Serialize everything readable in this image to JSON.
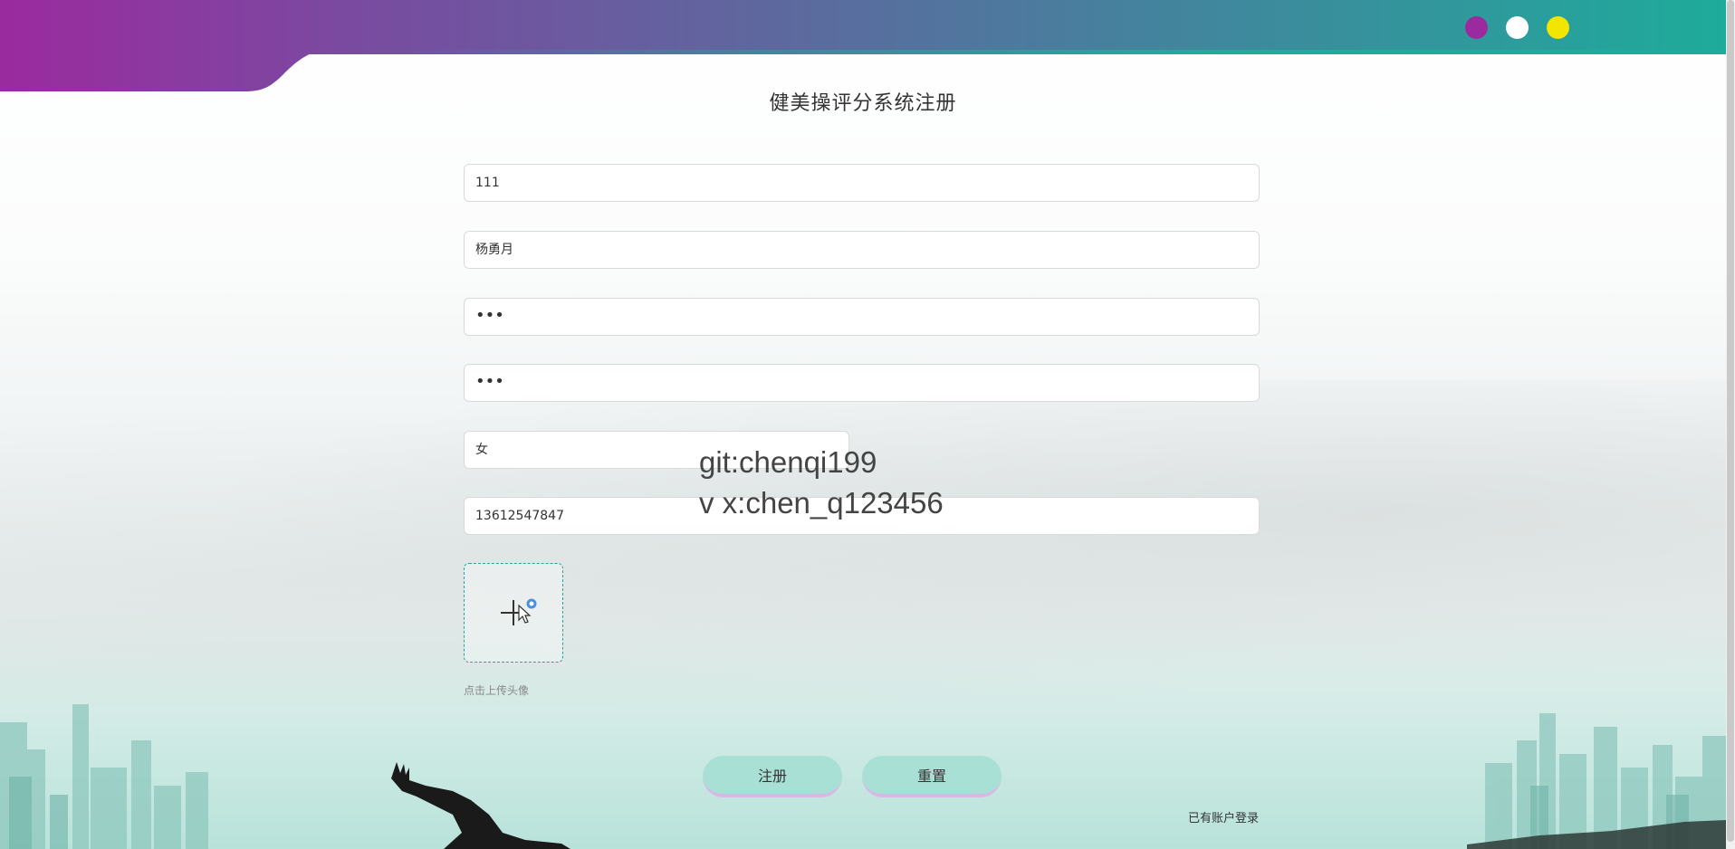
{
  "page": {
    "title": "健美操评分系统注册"
  },
  "theme": {
    "accent": "#1eab9b",
    "brand_purple": "#9b2a9f",
    "color_dots": [
      "#9b2a9f",
      "#ffffff",
      "#f2e600"
    ]
  },
  "form": {
    "account": {
      "value": "111"
    },
    "name": {
      "value": "杨勇月"
    },
    "password": {
      "value": "•••"
    },
    "confirm_password": {
      "value": "•••"
    },
    "gender": {
      "value": "女"
    },
    "phone": {
      "value": "13612547847"
    },
    "upload_hint": "点击上传头像"
  },
  "watermark": {
    "line1": "git:chenqi199",
    "line2": "v x:chen_q123456"
  },
  "buttons": {
    "register": "注册",
    "reset": "重置"
  },
  "login_link": "已有账户登录"
}
